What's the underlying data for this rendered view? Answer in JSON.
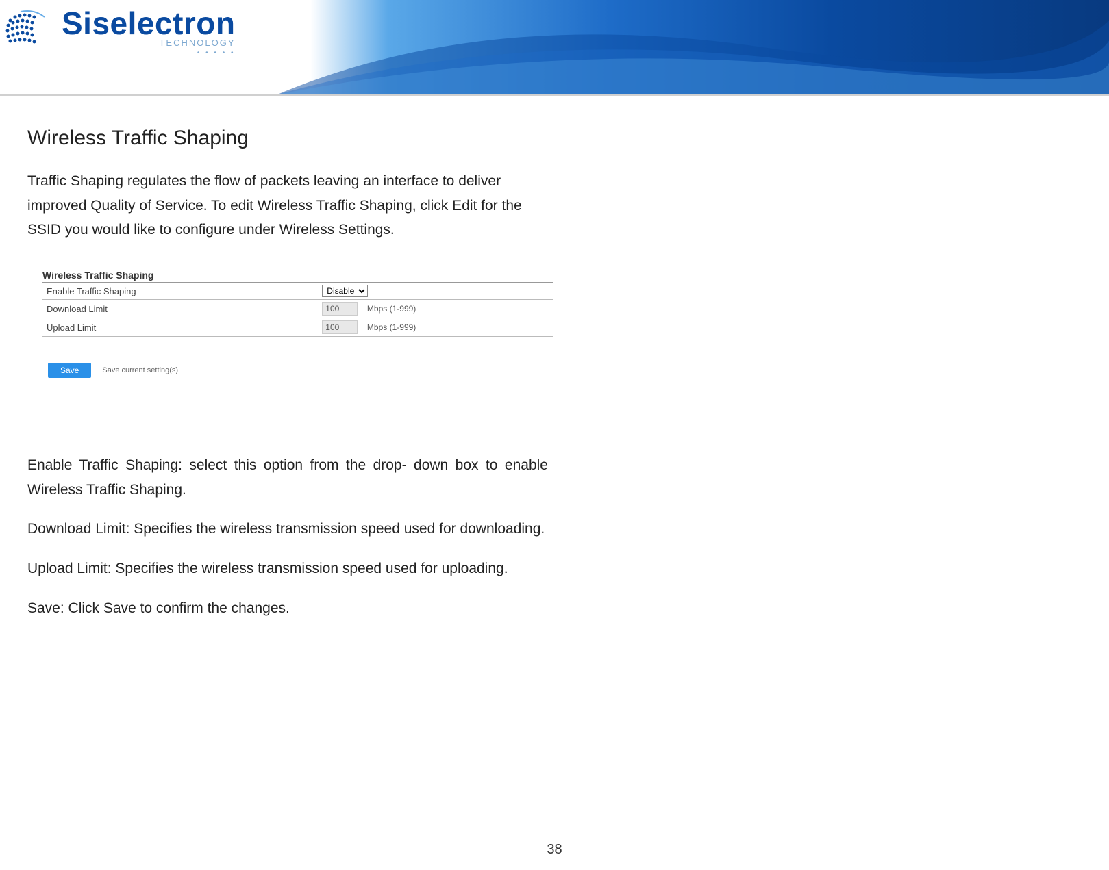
{
  "brand": {
    "name": "Siselectron",
    "subtitle": "TECHNOLOGY",
    "dots": "• • • • •"
  },
  "section": {
    "title": "Wireless Traffic  Shaping",
    "intro": "Traffic  Shaping   regulates the   flow  of  packets leaving an interface to  deliver improved Quality of Service. To edit Wireless Traffic Shaping, click Edit for the SSID you would  like to configure under Wireless Settings."
  },
  "screenshot": {
    "panel_title": "Wireless Traffic Shaping",
    "rows": {
      "enable": {
        "label": "Enable Traffic Shaping",
        "select_value": "Disable"
      },
      "download": {
        "label": "Download Limit",
        "value": "100",
        "unit": "Mbps (1-999)"
      },
      "upload": {
        "label": "Upload Limit",
        "value": "100",
        "unit": "Mbps (1-999)"
      }
    },
    "save_label": "Save",
    "save_hint": "Save current setting(s)"
  },
  "definitions": {
    "enable": "Enable Traffic  Shaping: select this  option   from  the  drop- down  box  to  enable Wireless  Traffic  Shaping.",
    "download": "Download Limit: Specifies  the  wireless transmission speed  used   for downloading.",
    "upload": "Upload   Limit:  Specifies   the   wireless  transmission  speed used   for uploading.",
    "save": "Save: Click Save to confirm the changes."
  },
  "page_number": "38"
}
